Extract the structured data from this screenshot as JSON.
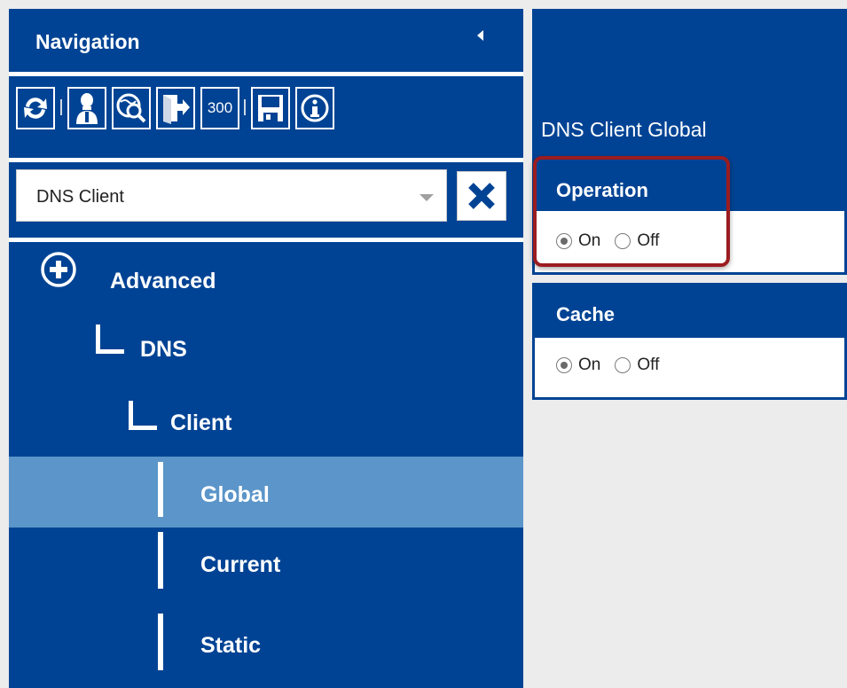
{
  "sidebar": {
    "title": "Navigation",
    "toolbar": {
      "buttons": [
        {
          "icon": "refresh-icon"
        },
        {
          "icon": "user-icon"
        },
        {
          "icon": "globe-search-icon"
        },
        {
          "icon": "logout-icon"
        },
        {
          "label": "300"
        },
        {
          "icon": "save-icon"
        },
        {
          "icon": "info-icon"
        }
      ]
    },
    "filter": {
      "value": "DNS Client"
    },
    "tree": {
      "items": [
        {
          "label": "Advanced"
        },
        {
          "label": "DNS"
        },
        {
          "label": "Client"
        },
        {
          "label": "Global",
          "selected": true
        },
        {
          "label": "Current"
        },
        {
          "label": "Static"
        }
      ]
    }
  },
  "main": {
    "title": "DNS Client Global",
    "sections": [
      {
        "title": "Operation",
        "options": [
          "On",
          "Off"
        ],
        "selected": "On"
      },
      {
        "title": "Cache",
        "options": [
          "On",
          "Off"
        ],
        "selected": "On"
      }
    ]
  },
  "colors": {
    "brand_blue": "#004394",
    "selected_row": "#5b95c9",
    "highlight_border": "#9b1c20",
    "background": "#ececec"
  }
}
